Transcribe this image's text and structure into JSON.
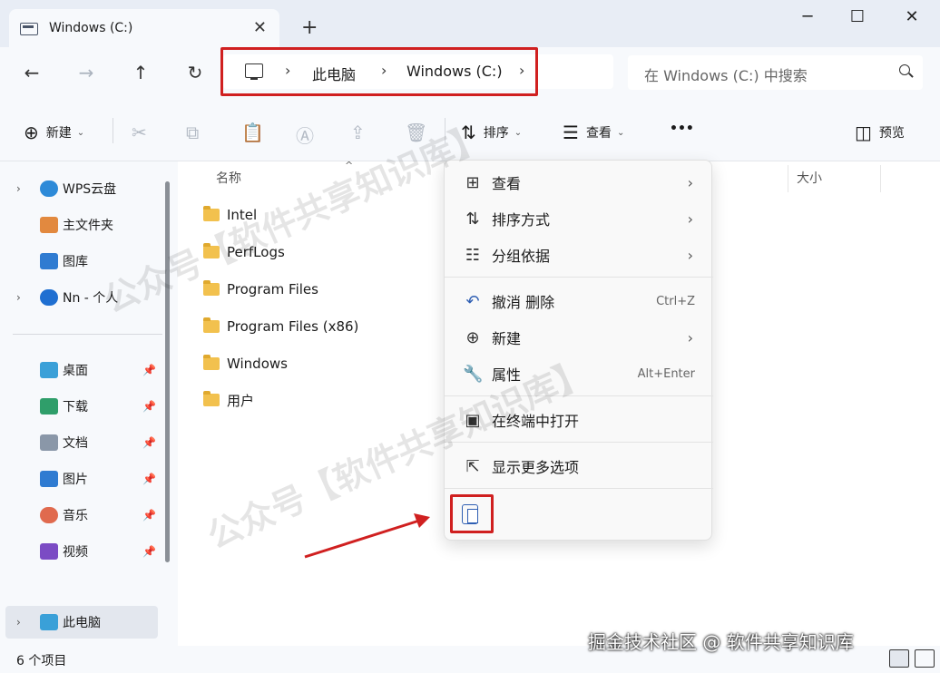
{
  "window": {
    "tab_title": "Windows (C:)",
    "tab_close": "✕",
    "new_tab": "+",
    "minimize": "─",
    "maximize": "☐",
    "close": "✕"
  },
  "nav": {
    "back": "←",
    "forward": "→",
    "up": "↑",
    "refresh": "↻",
    "breadcrumbs": [
      "此电脑",
      "Windows (C:)"
    ],
    "search_placeholder": "在 Windows (C:) 中搜索"
  },
  "toolbar": {
    "new_label": "新建",
    "sort_label": "排序",
    "view_label": "查看",
    "more": "•••",
    "preview_label": "预览"
  },
  "sidebar": {
    "items": [
      {
        "label": "WPS云盘",
        "expandable": true,
        "icon": "cloud-icon",
        "color": "#2d8ad8"
      },
      {
        "label": "主文件夹",
        "expandable": false,
        "icon": "home-icon",
        "color": "#e2893f"
      },
      {
        "label": "图库",
        "expandable": false,
        "icon": "gallery-icon",
        "color": "#2f7bd1"
      },
      {
        "label": "Nn - 个人",
        "expandable": true,
        "icon": "onedrive-icon",
        "color": "#1f6fd1"
      },
      {
        "label": "桌面",
        "pinned": true,
        "icon": "desktop-icon",
        "color": "#3aa0d8"
      },
      {
        "label": "下载",
        "pinned": true,
        "icon": "download-icon",
        "color": "#2f9e6a"
      },
      {
        "label": "文档",
        "pinned": true,
        "icon": "documents-icon",
        "color": "#8a97a8"
      },
      {
        "label": "图片",
        "pinned": true,
        "icon": "pictures-icon",
        "color": "#2f7bd1"
      },
      {
        "label": "音乐",
        "pinned": true,
        "icon": "music-icon",
        "color": "#e06a4e"
      },
      {
        "label": "视频",
        "pinned": true,
        "icon": "videos-icon",
        "color": "#7b4bc4"
      },
      {
        "label": "此电脑",
        "expandable": true,
        "icon": "this-pc-icon",
        "color": "#3aa0d8"
      }
    ]
  },
  "columns": {
    "name": "名称",
    "size": "大小"
  },
  "files": [
    "Intel",
    "PerfLogs",
    "Program Files",
    "Program Files (x86)",
    "Windows",
    "用户"
  ],
  "status": {
    "count": "6 个项目"
  },
  "context_menu": {
    "items": [
      {
        "label": "查看",
        "icon": "grid-icon",
        "submenu": true
      },
      {
        "label": "排序方式",
        "icon": "sort-icon",
        "submenu": true
      },
      {
        "label": "分组依据",
        "icon": "group-icon",
        "submenu": true
      },
      {
        "label": "撤消 删除",
        "icon": "undo-icon",
        "shortcut": "Ctrl+Z"
      },
      {
        "label": "新建",
        "icon": "new-icon",
        "submenu": true
      },
      {
        "label": "属性",
        "icon": "wrench-icon",
        "shortcut": "Alt+Enter"
      },
      {
        "label": "在终端中打开",
        "icon": "terminal-icon"
      },
      {
        "label": "显示更多选项",
        "icon": "more-options-icon"
      }
    ],
    "paste_icon": "paste-icon"
  },
  "watermarks": {
    "text": "公众号【软件共享知识库】",
    "footer": "掘金技术社区 @ 软件共享知识库"
  },
  "colors": {
    "highlight": "#d02020",
    "accent": "#2f5fb3"
  }
}
